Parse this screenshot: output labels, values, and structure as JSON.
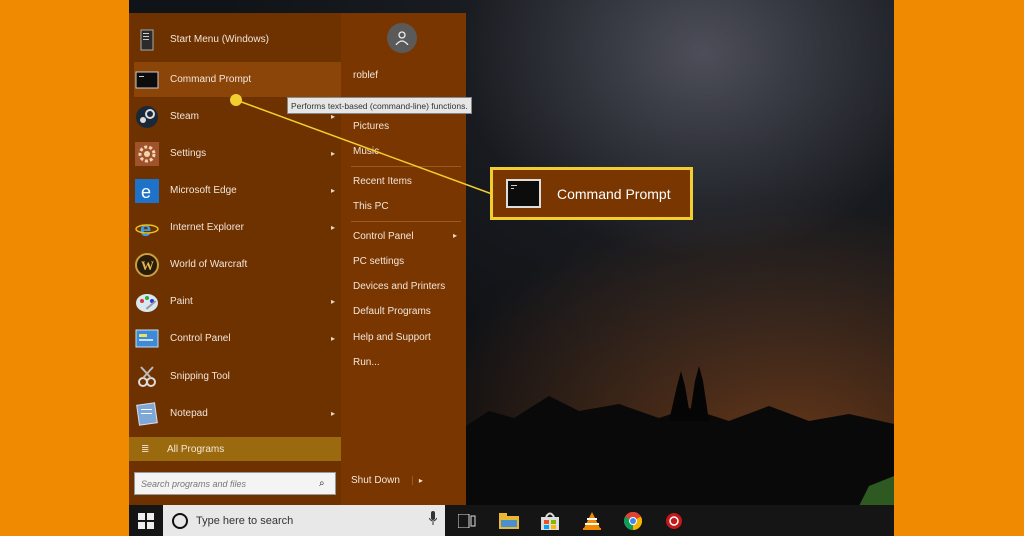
{
  "start_menu": {
    "items": [
      {
        "label": "Start Menu (Windows)",
        "icon": "start-menu-icon",
        "submenu": false
      },
      {
        "label": "Command Prompt",
        "icon": "command-prompt-icon",
        "submenu": false
      },
      {
        "label": "Steam",
        "icon": "steam-icon",
        "submenu": true
      },
      {
        "label": "Settings",
        "icon": "settings-icon",
        "submenu": true
      },
      {
        "label": "Microsoft Edge",
        "icon": "edge-icon",
        "submenu": true
      },
      {
        "label": "Internet Explorer",
        "icon": "internet-explorer-icon",
        "submenu": true
      },
      {
        "label": "World of Warcraft",
        "icon": "world-of-warcraft-icon",
        "submenu": false
      },
      {
        "label": "Paint",
        "icon": "paint-icon",
        "submenu": true
      },
      {
        "label": "Control Panel",
        "icon": "control-panel-icon",
        "submenu": true
      },
      {
        "label": "Snipping Tool",
        "icon": "snipping-tool-icon",
        "submenu": false
      },
      {
        "label": "Notepad",
        "icon": "notepad-icon",
        "submenu": true
      }
    ],
    "all_programs": "All Programs",
    "search_placeholder": "Search programs and files",
    "right": {
      "user": "roblef",
      "items": [
        "Pictures",
        "Music",
        "Recent Items",
        "This PC",
        "Control Panel",
        "PC settings",
        "Devices and Printers",
        "Default Programs",
        "Help and Support",
        "Run..."
      ],
      "shut_down": "Shut Down"
    }
  },
  "tooltip": "Performs text-based (command-line) functions.",
  "callout": {
    "label": "Command Prompt"
  },
  "taskbar": {
    "search_text": "Type here to search",
    "icons": [
      "task-view-icon",
      "file-explorer-icon",
      "store-icon",
      "vlc-icon",
      "chrome-icon",
      "app-icon"
    ]
  },
  "colors": {
    "background": "#F08A00",
    "menu": "#7A3600",
    "highlight": "#F2CE2E"
  }
}
